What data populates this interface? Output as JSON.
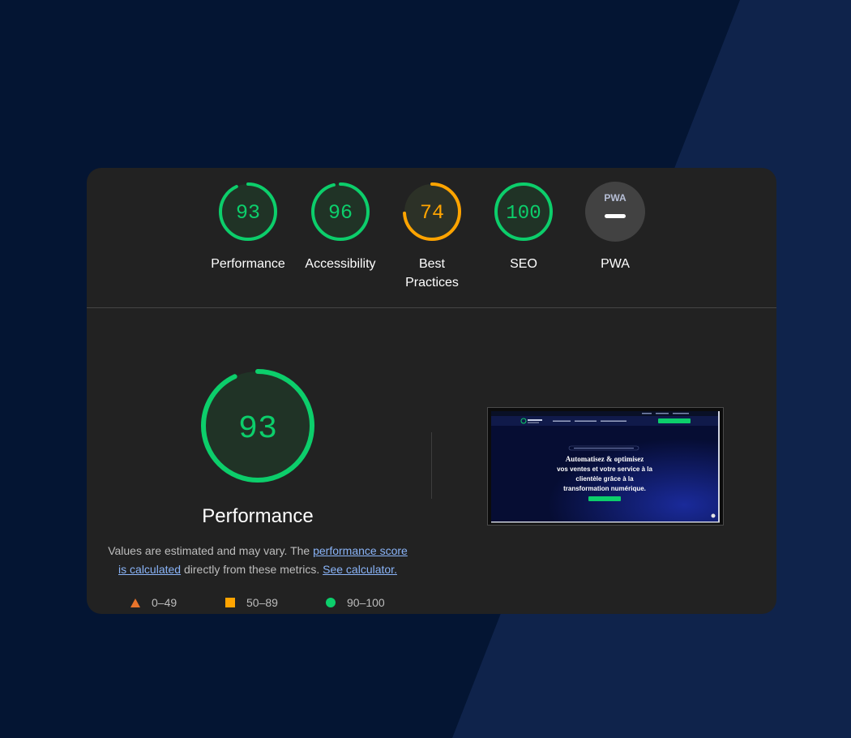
{
  "colors": {
    "pass": "#0cce6b",
    "average": "#ffa400",
    "fail": "#e8742b",
    "pwa_bg": "#424242",
    "card_bg": "#222222",
    "page_bg": "#041533"
  },
  "gauges": [
    {
      "id": "performance",
      "score": 93,
      "label": "Performance",
      "status": "pass"
    },
    {
      "id": "accessibility",
      "score": 96,
      "label": "Accessibility",
      "status": "pass"
    },
    {
      "id": "best-practices",
      "score": 74,
      "label_line1": "Best",
      "label_line2": "Practices",
      "status": "average"
    },
    {
      "id": "seo",
      "score": 100,
      "label": "SEO",
      "status": "pass"
    },
    {
      "id": "pwa",
      "badge_text": "PWA",
      "label": "PWA",
      "status": "na"
    }
  ],
  "detail": {
    "score": 93,
    "title": "Performance",
    "desc_prefix": "Values are estimated and may vary. The ",
    "link_score": "performance score is calculated",
    "desc_middle": " directly from these metrics. ",
    "link_calc": "See calculator.",
    "legend": [
      {
        "icon": "triangle-icon",
        "range": "0–49"
      },
      {
        "icon": "square-icon",
        "range": "50–89"
      },
      {
        "icon": "circle-icon",
        "range": "90–100"
      }
    ]
  },
  "screenshot": {
    "headline_line1": "Automatisez & optimisez",
    "headline_line2": "vos ventes et votre service à la",
    "headline_line3": "clientèle grâce à la",
    "headline_line4": "transformation numérique."
  }
}
